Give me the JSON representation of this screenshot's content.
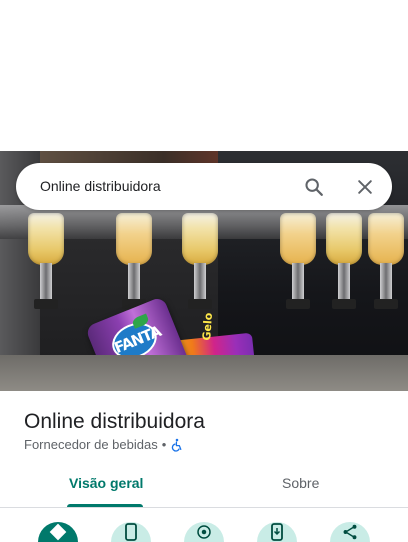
{
  "search": {
    "query": "Online distribuidora",
    "search_icon": "search-icon",
    "close_icon": "close-icon"
  },
  "photo": {
    "can_brand": "FANTA",
    "pack_label": "Gelo"
  },
  "place": {
    "name": "Online distribuidora",
    "category": "Fornecedor de bebidas",
    "separator": "•",
    "accessibility_icon": "wheelchair-icon"
  },
  "tabs": [
    {
      "label": "Visão geral",
      "active": true
    },
    {
      "label": "Sobre",
      "active": false
    }
  ],
  "actions": [
    {
      "icon": "directions-icon"
    },
    {
      "icon": "phone-icon"
    },
    {
      "icon": "location-icon"
    },
    {
      "icon": "save-to-phone-icon"
    },
    {
      "icon": "share-icon"
    }
  ],
  "colors": {
    "accent": "#00796b",
    "action_bg": "#c9ece6",
    "text_primary": "#202124",
    "text_secondary": "#5f6368",
    "accessibility_blue": "#1a73e8"
  }
}
